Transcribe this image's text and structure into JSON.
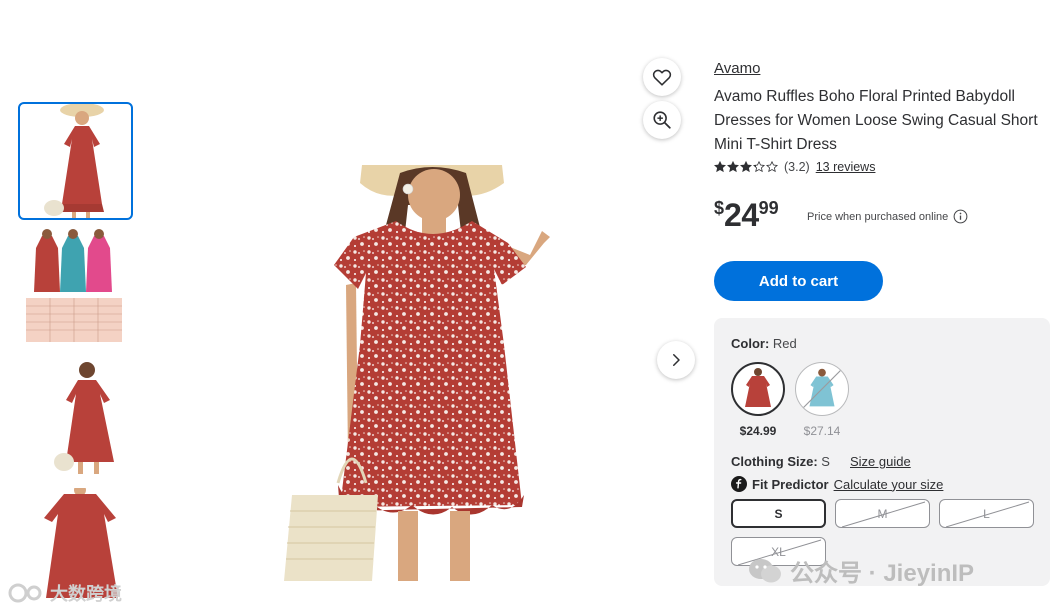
{
  "product": {
    "brand": "Avamo",
    "title": "Avamo Ruffles Boho Floral Printed Babydoll Dresses for Women Loose Swing Casual Short Mini T-Shirt Dress",
    "rating_value": 3.2,
    "rating_text": "(3.2)",
    "reviews_text": "13 reviews"
  },
  "price": {
    "currency": "$",
    "whole": "24",
    "cents": "99",
    "note": "Price when purchased online"
  },
  "actions": {
    "add_to_cart": "Add to cart"
  },
  "color": {
    "label": "Color:",
    "value": "Red",
    "options": [
      {
        "name": "Red",
        "price": "$24.99",
        "available": true,
        "selected": true
      },
      {
        "name": "Blue",
        "price": "$27.14",
        "available": false,
        "selected": false
      }
    ]
  },
  "size": {
    "label": "Clothing Size:",
    "value": "S",
    "guide_link": "Size guide",
    "fit_label": "Fit Predictor",
    "fit_link": "Calculate your size",
    "options": [
      {
        "label": "S",
        "available": true,
        "selected": true
      },
      {
        "label": "M",
        "available": false,
        "selected": false
      },
      {
        "label": "L",
        "available": false,
        "selected": false
      },
      {
        "label": "XL",
        "available": false,
        "selected": false
      }
    ]
  },
  "gallery": {
    "thumbnail_count": 4,
    "selected_index": 0
  },
  "watermarks": {
    "right": "公众号 · JieyinIP",
    "left": "大数跨境"
  },
  "icons": [
    "heart-icon",
    "zoom-in-icon",
    "chevron-right-icon",
    "star-icon",
    "info-icon",
    "fit-predictor-icon"
  ],
  "colors": {
    "accent": "#0071dc",
    "dress_red": "#b8413a",
    "panel_bg": "#f2f2f3"
  }
}
